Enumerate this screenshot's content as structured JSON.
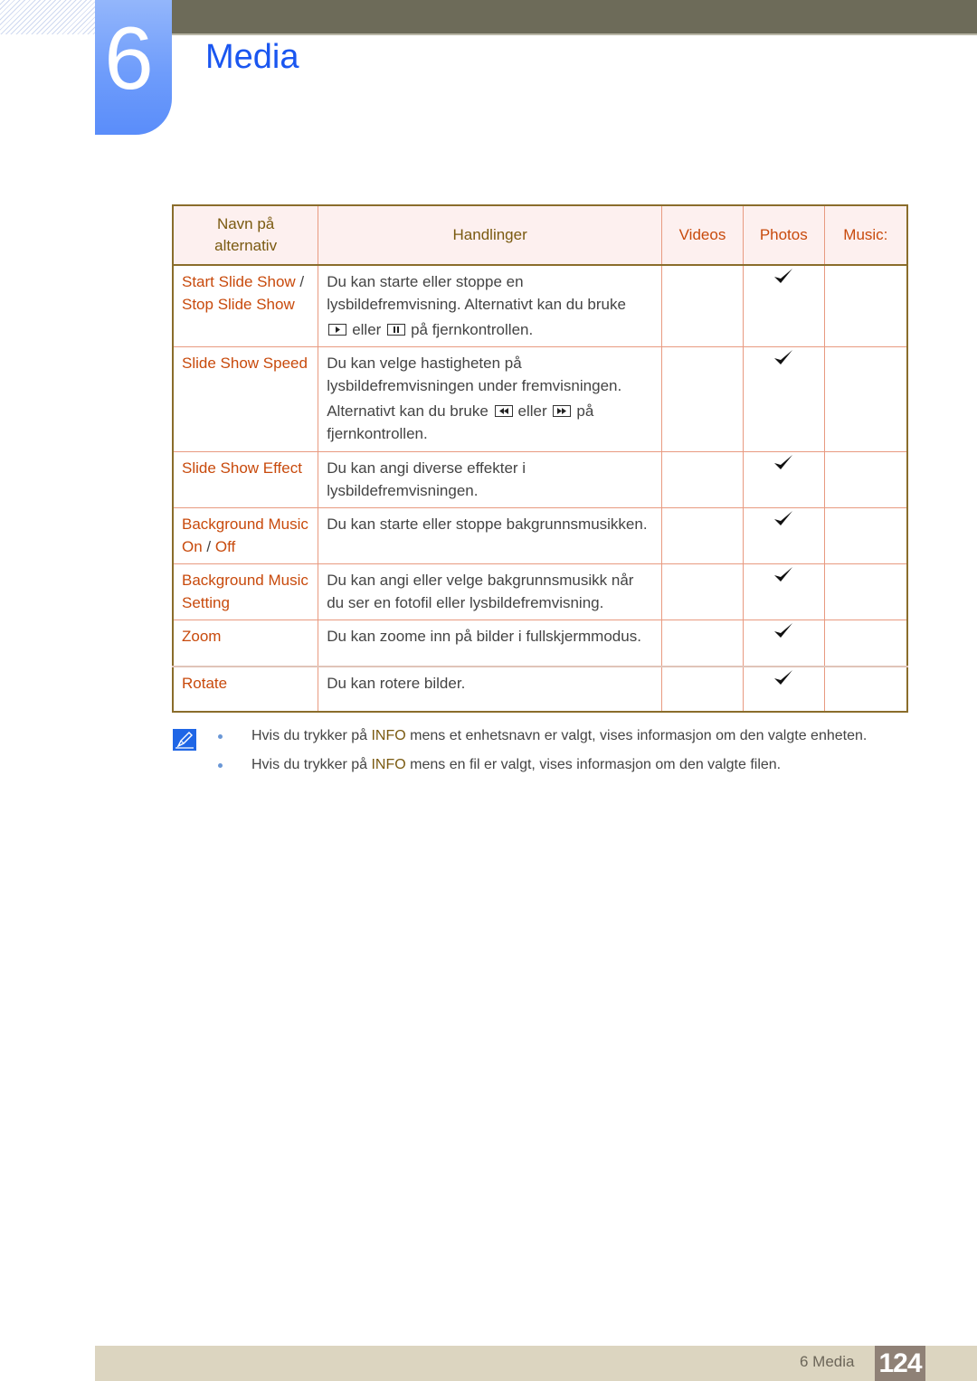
{
  "chapter": {
    "number": "6",
    "title": "Media"
  },
  "table": {
    "headers": {
      "name": [
        "Navn på",
        "alternativ"
      ],
      "actions": "Handlinger",
      "videos": "Videos",
      "photos": "Photos",
      "music": "Music:"
    },
    "rows": [
      {
        "name_parts": [
          "Start Slide Show",
          " / ",
          "Stop Slide Show"
        ],
        "desc_lines": [
          "Du kan starte eller stoppe en",
          "lysbildefremvisning. Alternativt kan du bruke"
        ],
        "desc_keys_line": {
          "key1": "play-key",
          "mid": "eller",
          "key2": "pause-key",
          "after": "på fjernkontrollen."
        },
        "videos": false,
        "photos": true,
        "music": false
      },
      {
        "name_parts": [
          "Slide Show Speed"
        ],
        "desc_lines": [
          "Du kan velge hastigheten på",
          "lysbildefremvisningen under fremvisningen."
        ],
        "desc_keys_line": {
          "before": "Alternativt kan du bruke",
          "key1": "rewind-key",
          "mid": "eller",
          "key2": "fast-forward-key",
          "after": "på"
        },
        "desc_tail": "fjernkontrollen.",
        "videos": false,
        "photos": true,
        "music": false
      },
      {
        "name_parts": [
          "Slide Show Effect"
        ],
        "desc": "Du kan angi diverse effekter i lysbildefremvisningen.",
        "videos": false,
        "photos": true,
        "music": false
      },
      {
        "name_parts": [
          "Background Music On",
          " / ",
          "Off"
        ],
        "desc": "Du kan starte eller stoppe bakgrunnsmusikken.",
        "videos": false,
        "photos": true,
        "music": false
      },
      {
        "name_parts": [
          "Background Music Setting"
        ],
        "desc": "Du kan angi eller velge bakgrunnsmusikk når du ser en fotofil eller lysbildefremvisning.",
        "videos": false,
        "photos": true,
        "music": false
      },
      {
        "name_parts": [
          "Zoom"
        ],
        "desc": "Du kan zoome inn på bilder i fullskjermmodus.",
        "videos": false,
        "photos": true,
        "music": false
      },
      {
        "name_parts": [
          "Rotate"
        ],
        "desc": "Du kan rotere bilder.",
        "videos": false,
        "photos": true,
        "music": false
      }
    ]
  },
  "notes": [
    {
      "before": "Hvis du trykker på ",
      "highlight": "INFO",
      "after": " mens et enhetsnavn er valgt, vises informasjon om den valgte enheten."
    },
    {
      "before": "Hvis du trykker på ",
      "highlight": "INFO",
      "after": " mens en fil er valgt, vises informasjon om den valgte filen."
    }
  ],
  "footer": {
    "label": "6 Media",
    "page": "124"
  }
}
